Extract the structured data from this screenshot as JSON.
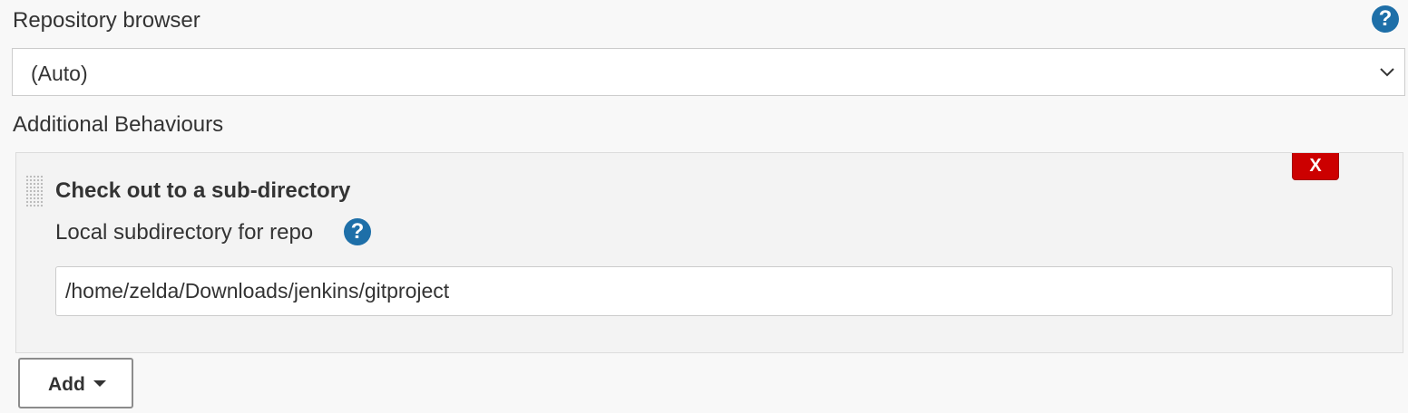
{
  "repository_browser": {
    "label": "Repository browser",
    "help_glyph": "?",
    "selected_value": "(Auto)"
  },
  "additional_behaviours": {
    "label": "Additional Behaviours",
    "behaviour": {
      "title": "Check out to a sub-directory",
      "delete_label": "X",
      "field_label": "Local subdirectory for repo",
      "help_glyph": "?",
      "field_value": "/home/zelda/Downloads/jenkins/gitproject"
    },
    "add_label": "Add"
  },
  "colors": {
    "help_icon": "#1e6fa8",
    "delete_button": "#cc0000",
    "background": "#f8f8f8"
  },
  "icons": {
    "help": "help-icon",
    "dropdown": "chevron-down-icon",
    "drag": "drag-handle-icon",
    "add_caret": "caret-down-icon"
  }
}
